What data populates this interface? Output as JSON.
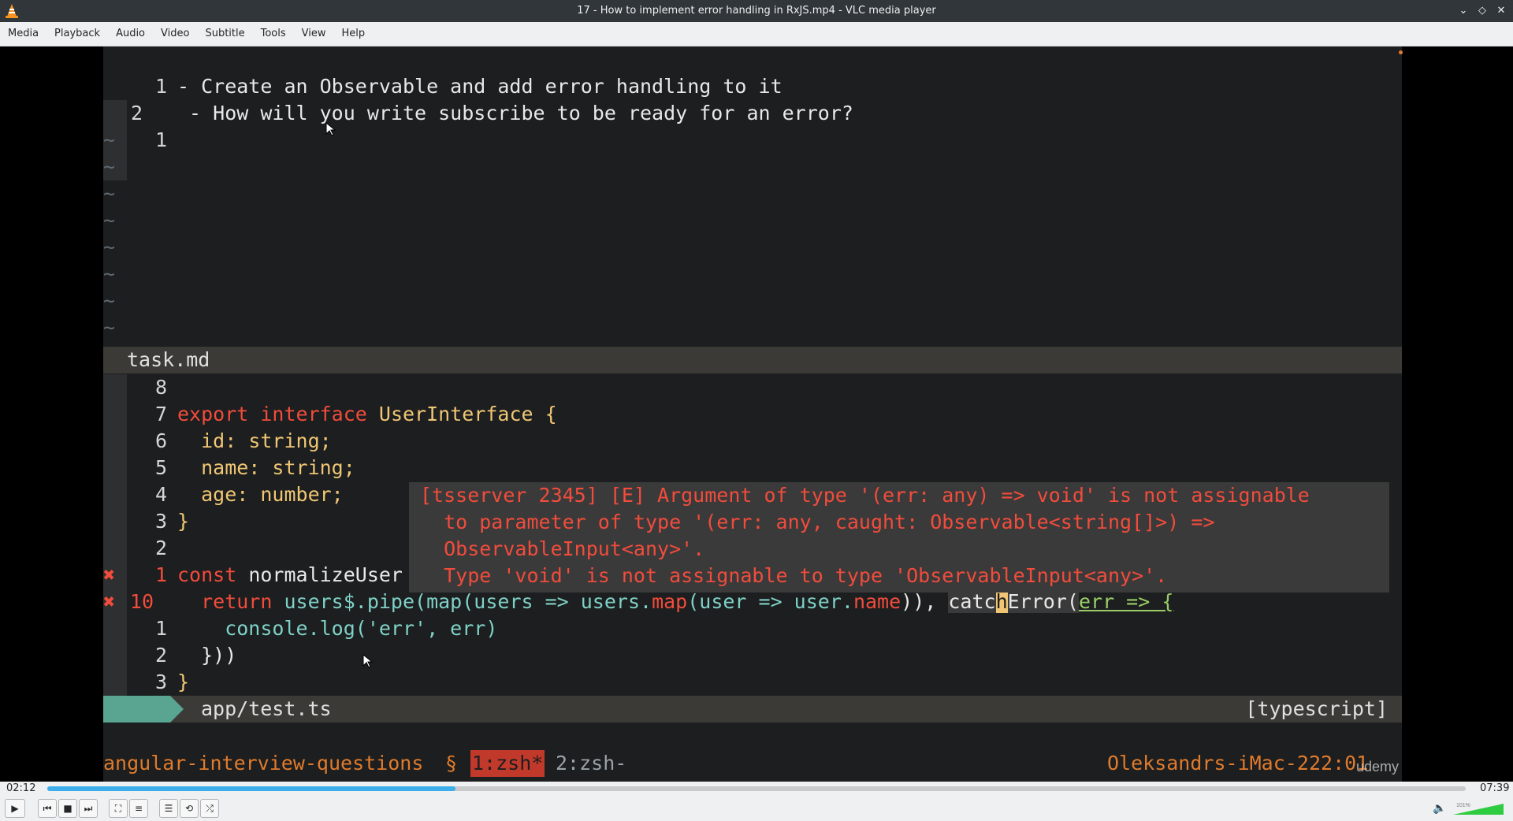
{
  "window": {
    "title": "17 - How to implement error handling in RxJS.mp4 - VLC media player"
  },
  "menu": [
    "Media",
    "Playback",
    "Audio",
    "Video",
    "Subtitle",
    "Tools",
    "View",
    "Help"
  ],
  "task_pane": {
    "lines": [
      {
        "num": "1",
        "text": "- Create an Observable and add error handling to it"
      },
      {
        "num": "2",
        "text": " - How will you write subscribe to be ready for an error?"
      },
      {
        "num": "1",
        "text": ""
      }
    ],
    "tilde": "~",
    "filename": "task.md"
  },
  "code_pane": {
    "l8": "8",
    "l7": "7",
    "l6": "6",
    "l5": "5",
    "l4": "4",
    "l3a": "3",
    "l2a": "2",
    "l1a": "1",
    "l10": "10",
    "l1b": "1",
    "l2b": "2",
    "l3b": "3",
    "export": "export",
    "interface": "interface",
    "iface_name": "UserInterface",
    "brace_open": " {",
    "id_key": "  id: ",
    "id_type": "string;",
    "name_key": "  name: ",
    "name_type": "string;",
    "age_key": "  age: ",
    "age_type": "number;",
    "brace_close": "}",
    "const": "const",
    "normalize": " normalizeUser",
    "return_kw": "  return ",
    "pipe_part1": "users$.pipe(map(users => users.",
    "map_kw": "map",
    "pipe_part2": "(user => user.",
    "name_prop": "name",
    "pipe_part3": ")), ",
    "catch_a": "catc",
    "catch_cursor": "h",
    "catch_b": "Error(",
    "err_arrow": "err => {",
    "console": "    console.log('err', err)",
    "close_paren": "  }))",
    "final_brace": "}",
    "err_mark": "✖",
    "filename": "app/test.ts",
    "filetype": "[typescript]"
  },
  "error_popup": {
    "line1": "[tsserver 2345] [E] Argument of type '(err: any) => void' is not assignable",
    "line2": "  to parameter of type '(err: any, caught: Observable<string[]>) =>",
    "line3": "  ObservableInput<any>'.",
    "line4": "  Type 'void' is not assignable to type 'ObservableInput<any>'."
  },
  "tmux": {
    "session": "angular-interview-questions",
    "sep": "§",
    "win1": "1:zsh*",
    "win2": "2:zsh-",
    "host": "Oleksandrs-iMac-2",
    "clock": "22:01",
    "watermark": "udemy"
  },
  "player": {
    "elapsed": "02:12",
    "total": "07:39",
    "progress_fraction": 0.288,
    "volume_label": "101%",
    "volume_fraction": 1.0
  },
  "colors": {
    "accent": "#3daee9",
    "error": "#f14c3c",
    "type": "#f0c674",
    "green": "#9acd68"
  },
  "icons": [
    "vlc-cone-icon",
    "minimize-icon",
    "maximize-icon",
    "close-icon",
    "play-icon",
    "prev-icon",
    "stop-icon",
    "next-icon",
    "fullscreen-icon",
    "extended-settings-icon",
    "playlist-icon",
    "loop-icon",
    "shuffle-icon",
    "speaker-icon"
  ]
}
